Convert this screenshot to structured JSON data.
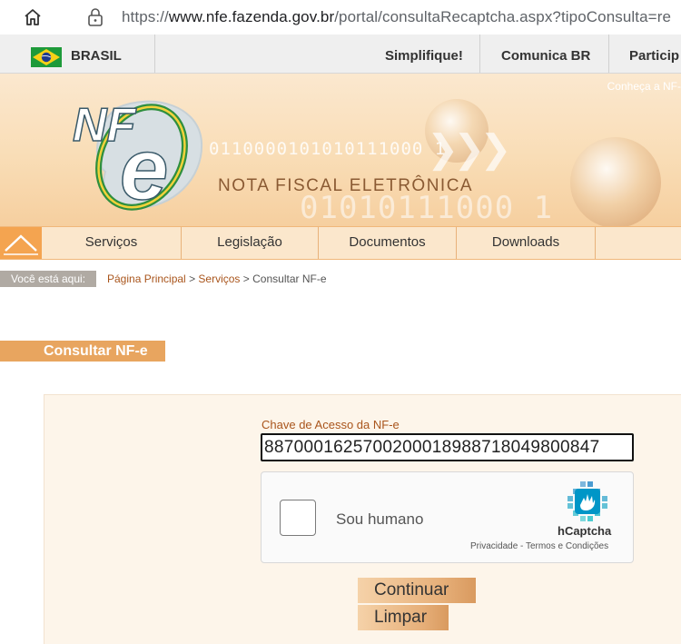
{
  "browser": {
    "url_prefix": "https://",
    "url_domain": "www.nfe.fazenda.gov.br",
    "url_path": "/portal/consultaRecaptcha.aspx?tipoConsulta=re"
  },
  "gov_bar": {
    "country": "BRASIL",
    "links": [
      "Simplifique!",
      "Comunica BR",
      "Particip"
    ]
  },
  "banner": {
    "conheca": "Conheça a NF-",
    "title": "NOTA FISCAL ELETRÔNICA",
    "binary_top": "0110000101010111000 1",
    "binary_bottom": "01010111000 1",
    "logo_text": "NF",
    "logo_e": "e"
  },
  "nav": {
    "items": [
      "Serviços",
      "Legislação",
      "Documentos",
      "Downloads"
    ]
  },
  "breadcrumb": {
    "label": "Você está aqui:",
    "home": "Página Principal",
    "section": "Serviços",
    "current": "Consultar NF-e",
    "sep": ">"
  },
  "form": {
    "title": "Consultar NF-e",
    "chave_label": "Chave de Acesso da NF-e",
    "chave_value": "8870001625700200018988718049800847",
    "captcha_text": "Sou humano",
    "captcha_brand": "hCaptcha",
    "captcha_links": "Privacidade - Termos e Condições",
    "continuar": "Continuar",
    "limpar": "Limpar"
  },
  "colors": {
    "accent": "#e8a55f",
    "link": "#a9551c",
    "nav_bg": "#fbe7cc"
  }
}
